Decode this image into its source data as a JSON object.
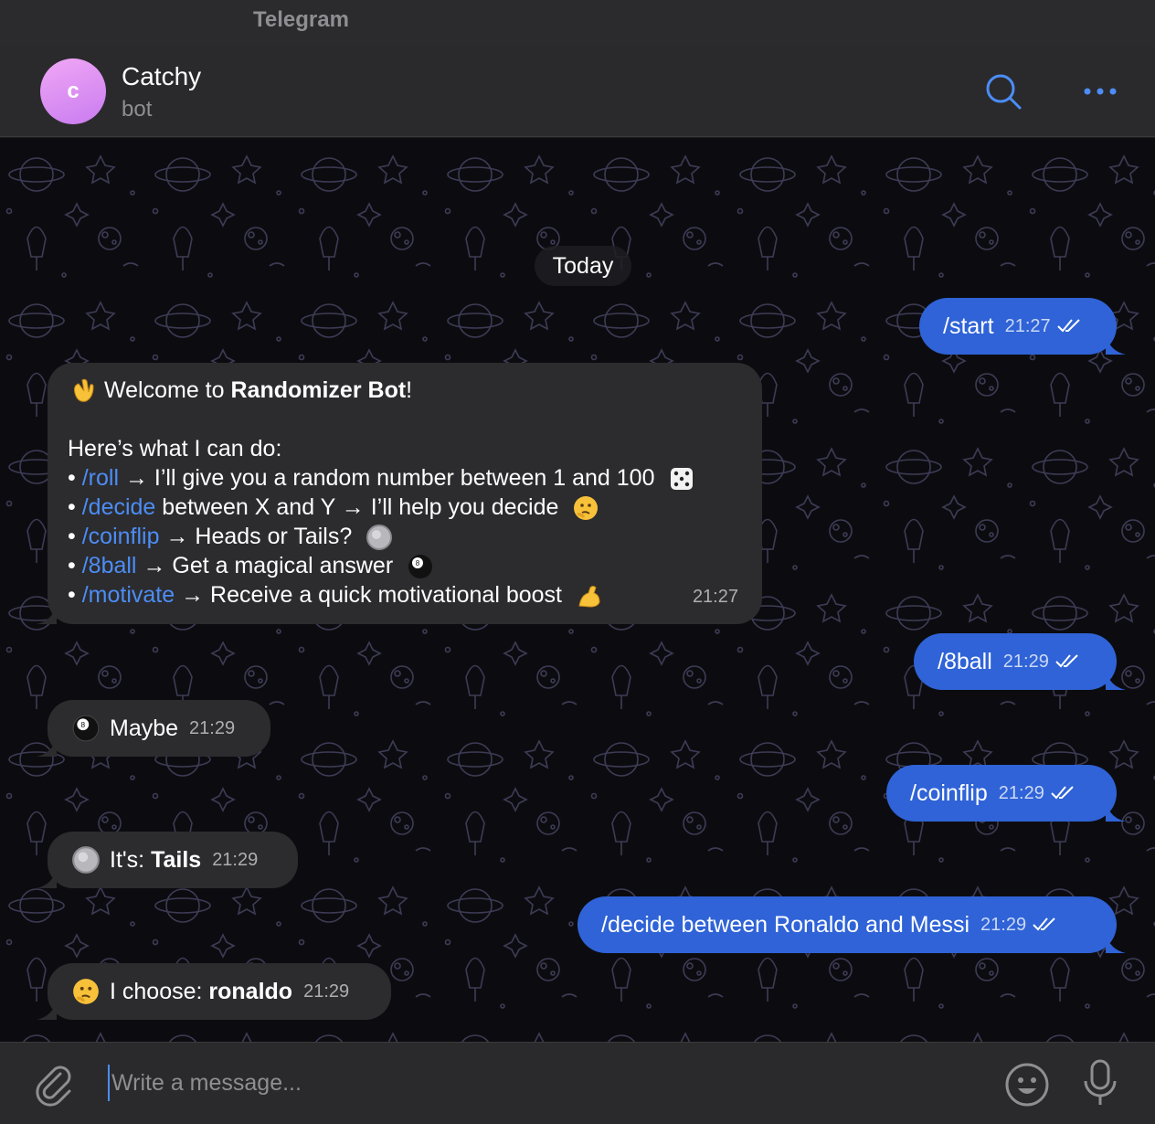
{
  "window": {
    "title": "Telegram"
  },
  "header": {
    "avatar_letter": "c",
    "name": "Catchy",
    "subtitle": "bot",
    "search_icon": "search-icon",
    "more_icon": "more-icon"
  },
  "date_divider": "Today",
  "messages": {
    "start": {
      "text": "/start",
      "time": "21:27"
    },
    "welcome": {
      "line1_prefix": "Welcome to ",
      "line1_bold": "Randomizer Bot",
      "line1_suffix": "!",
      "intro": "Here’s what I can do:",
      "items": [
        {
          "bullet": "•",
          "cmd": "/roll",
          "text": "→ I’ll give you a random number between 1 and 100"
        },
        {
          "bullet": "•",
          "cmd": "/decide",
          "text": "between X and Y → I’ll help you decide"
        },
        {
          "bullet": "•",
          "cmd": "/coinflip",
          "text": "→ Heads or Tails?"
        },
        {
          "bullet": "•",
          "cmd": "/8ball",
          "text": "→ Get a magical answer"
        },
        {
          "bullet": "•",
          "cmd": "/motivate",
          "text": "→ Receive a quick motivational boost"
        }
      ],
      "time": "21:27"
    },
    "eightball_cmd": {
      "text": "/8ball",
      "time": "21:29"
    },
    "maybe": {
      "text": "Maybe",
      "time": "21:29"
    },
    "coinflip_cmd": {
      "text": "/coinflip",
      "time": "21:29"
    },
    "tails": {
      "prefix": "It's: ",
      "bold": "Tails",
      "time": "21:29"
    },
    "decide_cmd": {
      "text": "/decide between Ronaldo and Messi",
      "time": "21:29"
    },
    "choose": {
      "prefix": "I choose: ",
      "bold": "ronaldo",
      "time": "21:29"
    }
  },
  "composer": {
    "placeholder": "Write a message..."
  },
  "colors": {
    "accent": "#2f63d7",
    "link": "#4c8df6",
    "incoming": "#2c2c2e",
    "background": "#0c0c10"
  }
}
